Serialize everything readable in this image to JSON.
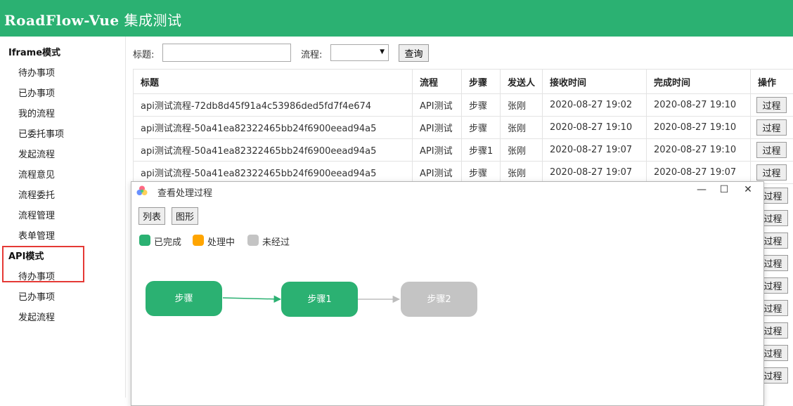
{
  "header": {
    "title_main": "RoadFlow-Vue",
    "title_suffix": " 集成测试"
  },
  "sidebar": {
    "groups": [
      {
        "title": "Iframe模式",
        "items": [
          "待办事项",
          "已办事项",
          "我的流程",
          "已委托事项",
          "发起流程",
          "流程意见",
          "流程委托",
          "流程管理",
          "表单管理"
        ]
      },
      {
        "title": "API模式",
        "items": [
          "待办事项",
          "已办事项",
          "发起流程"
        ]
      }
    ]
  },
  "search": {
    "title_label": "标题:",
    "title_value": "",
    "flow_label": "流程:",
    "flow_selected": "",
    "query_button": "查询"
  },
  "table": {
    "columns": [
      "标题",
      "流程",
      "步骤",
      "发送人",
      "接收时间",
      "完成时间",
      "操作"
    ],
    "rows": [
      {
        "title": "api测试流程-72db8d45f91a4c53986ded5fd7f4e674",
        "flow": "API测试",
        "step": "步骤",
        "sender": "张刚",
        "received": "2020-08-27 19:02",
        "completed": "2020-08-27 19:10",
        "action": "过程"
      },
      {
        "title": "api测试流程-50a41ea82322465bb24f6900eead94a5",
        "flow": "API测试",
        "step": "步骤",
        "sender": "张刚",
        "received": "2020-08-27 19:10",
        "completed": "2020-08-27 19:10",
        "action": "过程"
      },
      {
        "title": "api测试流程-50a41ea82322465bb24f6900eead94a5",
        "flow": "API测试",
        "step": "步骤1",
        "sender": "张刚",
        "received": "2020-08-27 19:07",
        "completed": "2020-08-27 19:10",
        "action": "过程"
      },
      {
        "title": "api测试流程-50a41ea82322465bb24f6900eead94a5",
        "flow": "API测试",
        "step": "步骤",
        "sender": "张刚",
        "received": "2020-08-27 19:07",
        "completed": "2020-08-27 19:07",
        "action": "过程"
      }
    ],
    "hidden_row_action": "过程"
  },
  "dialog": {
    "title": "查看处理过程",
    "window_controls": {
      "minimize": "—",
      "maximize": "☐",
      "close": "✕"
    },
    "view_buttons": [
      "列表",
      "图形"
    ],
    "legend": [
      {
        "label": "已完成",
        "color": "#2bb172"
      },
      {
        "label": "处理中",
        "color": "#ffa500"
      },
      {
        "label": "未经过",
        "color": "#c4c4c4"
      }
    ],
    "flow_steps": [
      {
        "label": "步骤",
        "status": "已完成",
        "color": "#2bb172"
      },
      {
        "label": "步骤1",
        "status": "已完成",
        "color": "#2bb172"
      },
      {
        "label": "步骤2",
        "status": "未经过",
        "color": "#c4c4c4"
      }
    ],
    "connector_colors": [
      "#2bb172",
      "#bdbdbd"
    ]
  },
  "colors": {
    "brand": "#2bb172",
    "highlight": "#e53935"
  }
}
